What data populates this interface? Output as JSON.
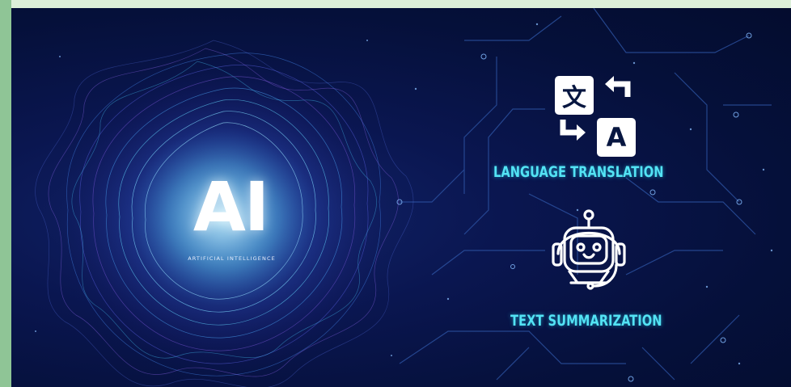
{
  "hero": {
    "title": "AI",
    "subtitle": "ARTIFICIAL INTELLIGENCE"
  },
  "features": [
    {
      "icon": "translate-icon",
      "label": "LANGUAGE TRANSLATION"
    },
    {
      "icon": "robot-headset-icon",
      "label": "TEXT SUMMARIZATION"
    }
  ],
  "translate_glyphs": {
    "cjk": "文",
    "latin": "A"
  },
  "colors": {
    "background": "#05103a",
    "accent": "#53e3f4",
    "frame": "#a9d3ad"
  }
}
